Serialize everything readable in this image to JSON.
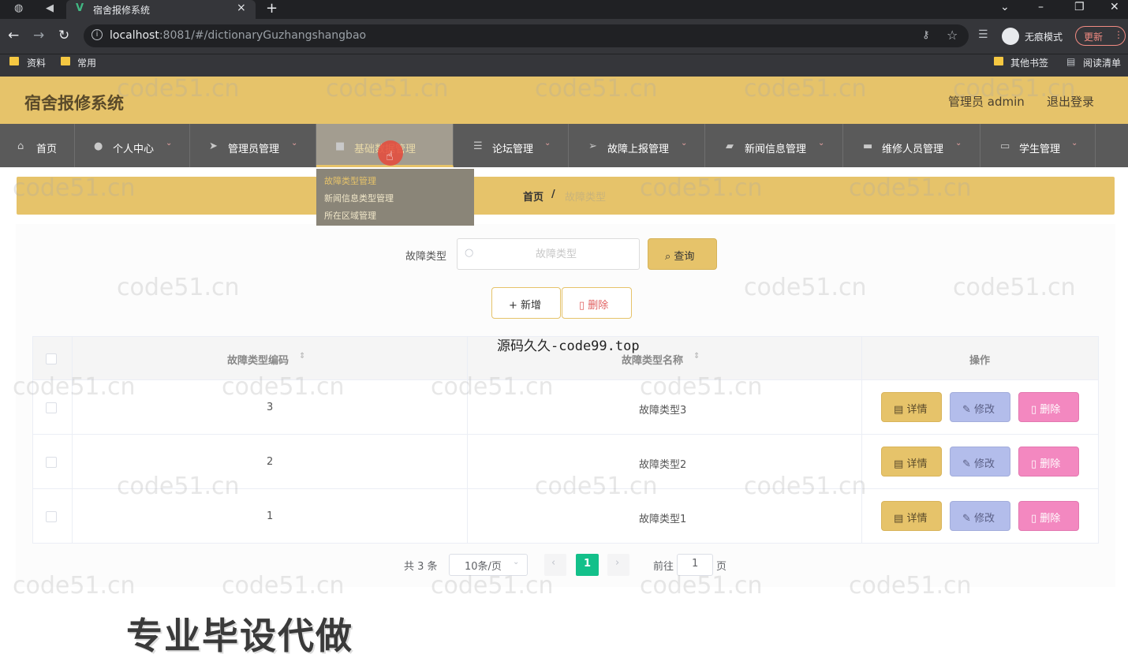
{
  "browser": {
    "tab_title": "宿舍报修系统",
    "url_host": "localhost",
    "url_rest": ":8081/#/dictionaryGuzhangshangbao",
    "incognito_label": "无痕模式",
    "update_label": "更新",
    "bookmarks": [
      "资料",
      "常用"
    ],
    "other_bookmarks": "其他书签",
    "reading_list": "阅读清单"
  },
  "header": {
    "title": "宿舍报修系统",
    "user": "管理员 admin",
    "logout": "退出登录"
  },
  "nav": {
    "items": [
      {
        "label": "首页"
      },
      {
        "label": "个人中心"
      },
      {
        "label": "管理员管理"
      },
      {
        "label": "基础数据管理"
      },
      {
        "label": "论坛管理"
      },
      {
        "label": "故障上报管理"
      },
      {
        "label": "新闻信息管理"
      },
      {
        "label": "维修人员管理"
      },
      {
        "label": "学生管理"
      }
    ],
    "dropdown": [
      "故障类型管理",
      "新闻信息类型管理",
      "所在区域管理"
    ]
  },
  "breadcrumb": {
    "home": "首页",
    "sep": "/",
    "current": "故障类型"
  },
  "search": {
    "label": "故障类型",
    "placeholder": "故障类型",
    "query_btn": "查询"
  },
  "actions": {
    "add": "新增",
    "delete": "删除"
  },
  "table": {
    "columns": [
      "故障类型编码",
      "故障类型名称",
      "操作"
    ],
    "rows": [
      {
        "code": "3",
        "name": "故障类型3"
      },
      {
        "code": "2",
        "name": "故障类型2"
      },
      {
        "code": "1",
        "name": "故障类型1"
      }
    ],
    "row_actions": {
      "detail": "详情",
      "edit": "修改",
      "delete": "删除"
    }
  },
  "pagination": {
    "total": "共 3 条",
    "page_size": "10条/页",
    "current": "1",
    "goto": "前往",
    "goto_value": "1",
    "unit": "页"
  },
  "overlays": {
    "watermark": "code51.cn",
    "mid_watermark": "源码久久-code99.top",
    "bottom_text": "专业毕设代做"
  }
}
